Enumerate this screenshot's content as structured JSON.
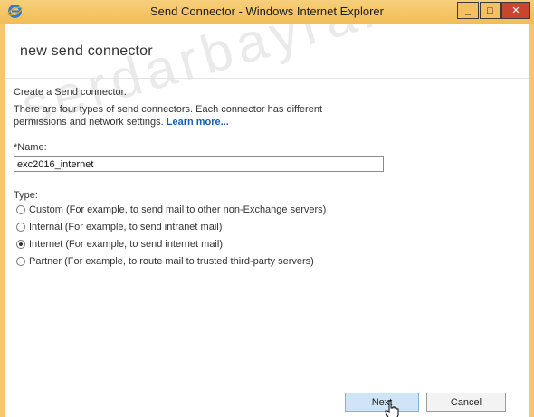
{
  "window": {
    "title": "Send Connector - Windows Internet Explorer",
    "controls": {
      "minimize": "_",
      "maximize": "□",
      "close": "✕"
    }
  },
  "page": {
    "heading": "new send connector",
    "intro": "Create a Send connector.",
    "description": "There are four types of send connectors. Each connector has different permissions and network settings.",
    "learn_more": "Learn more...",
    "name_label": "*Name:",
    "name_value": "exc2016_internet",
    "type_label": "Type:",
    "types": [
      {
        "label": "Custom (For example, to send mail to other non-Exchange servers)",
        "selected": false
      },
      {
        "label": "Internal (For example, to send intranet mail)",
        "selected": false
      },
      {
        "label": "Internet (For example, to send internet mail)",
        "selected": true
      },
      {
        "label": "Partner (For example, to route mail to trusted third-party servers)",
        "selected": false
      }
    ]
  },
  "watermark": "serdarbayram.net",
  "buttons": {
    "next": "Next",
    "cancel": "Cancel"
  }
}
